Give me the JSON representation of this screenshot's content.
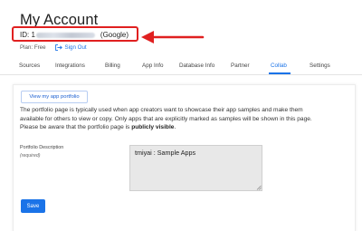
{
  "header": {
    "title": "My Account",
    "id_prefix": "ID: 1",
    "id_provider": "(Google)",
    "plan_text": "Plan: Free",
    "sign_out_label": "Sign Out"
  },
  "tabs": [
    {
      "label": "Sources"
    },
    {
      "label": "Integrations"
    },
    {
      "label": "Billing"
    },
    {
      "label": "App Info"
    },
    {
      "label": "Database Info"
    },
    {
      "label": "Partner"
    },
    {
      "label": "Collab",
      "active": true
    },
    {
      "label": "Settings"
    }
  ],
  "collab": {
    "portfolio_button_label": "View my app portfolio",
    "description": "The portfolio page is typically used when app creators want to showcase their app samples and make them available for others to view or copy. Only apps that are explicitly marked as samples will be shown in this page. Please be aware that the portfolio page is",
    "description_emphasis": "publicly visible",
    "description_end": ".",
    "field_label": "Portfolio Description",
    "field_required": "(required)",
    "field_value": "tmiyai : Sample Apps",
    "save_label": "Save"
  },
  "colors": {
    "accent": "#1a73e8",
    "highlight_box": "#e02020",
    "textarea_bg": "#e8e8e8"
  },
  "icons": {
    "sign_out": "sign-out-icon",
    "annotation_arrow": "arrow-left-icon",
    "resize": "resize-grip-icon"
  }
}
